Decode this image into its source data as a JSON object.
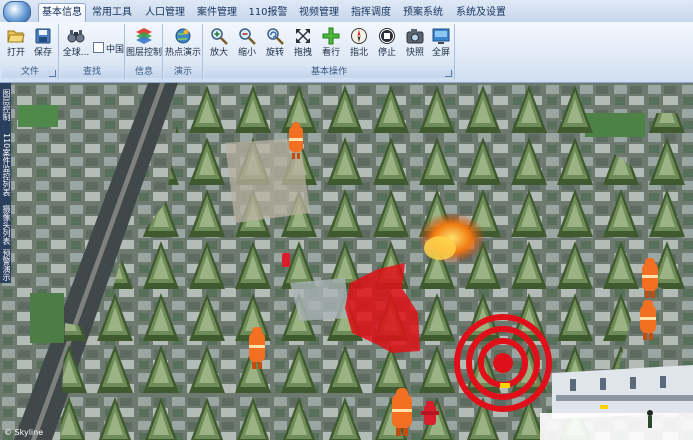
{
  "tabs": [
    "基本信息",
    "常用工具",
    "人口管理",
    "案件管理",
    "110报警",
    "视频管理",
    "指挥调度",
    "预案系统",
    "系统及设置"
  ],
  "active_tab": "基本信息",
  "ribbon": {
    "groups": {
      "file": {
        "label": "文件",
        "buttons": [
          {
            "label": "打开",
            "icon": "folder-open-icon"
          },
          {
            "label": "保存",
            "icon": "save-icon"
          }
        ]
      },
      "query": {
        "label": "查找",
        "buttons": [
          {
            "label": "全球...",
            "icon": "binoculars-icon"
          }
        ],
        "checkbox": {
          "label": "中国",
          "checked": false
        }
      },
      "info": {
        "label": "信息",
        "buttons": [
          {
            "label": "图层控制",
            "icon": "layers-icon"
          }
        ]
      },
      "demo": {
        "label": "演示",
        "buttons": [
          {
            "label": "热点演示",
            "icon": "globe-hotspot-icon"
          }
        ]
      },
      "basic_ops": {
        "label": "基本操作",
        "buttons": [
          {
            "label": "放大",
            "icon": "zoom-in-icon"
          },
          {
            "label": "缩小",
            "icon": "zoom-out-icon"
          },
          {
            "label": "旋转",
            "icon": "rotate-icon"
          },
          {
            "label": "拖拽",
            "icon": "drag-icon"
          },
          {
            "label": "看行",
            "icon": "walk-icon"
          },
          {
            "label": "指北",
            "icon": "compass-icon"
          },
          {
            "label": "停止",
            "icon": "stop-icon"
          },
          {
            "label": "快照",
            "icon": "camera-icon"
          },
          {
            "label": "全屏",
            "icon": "fullscreen-icon"
          }
        ]
      }
    }
  },
  "side_panel_tabs": [
    "图层控制",
    "110案件监控列表",
    "摄像头列表",
    "预警演示"
  ],
  "map": {
    "watermark": "© Skyline",
    "alert_color": "#e0101a"
  }
}
